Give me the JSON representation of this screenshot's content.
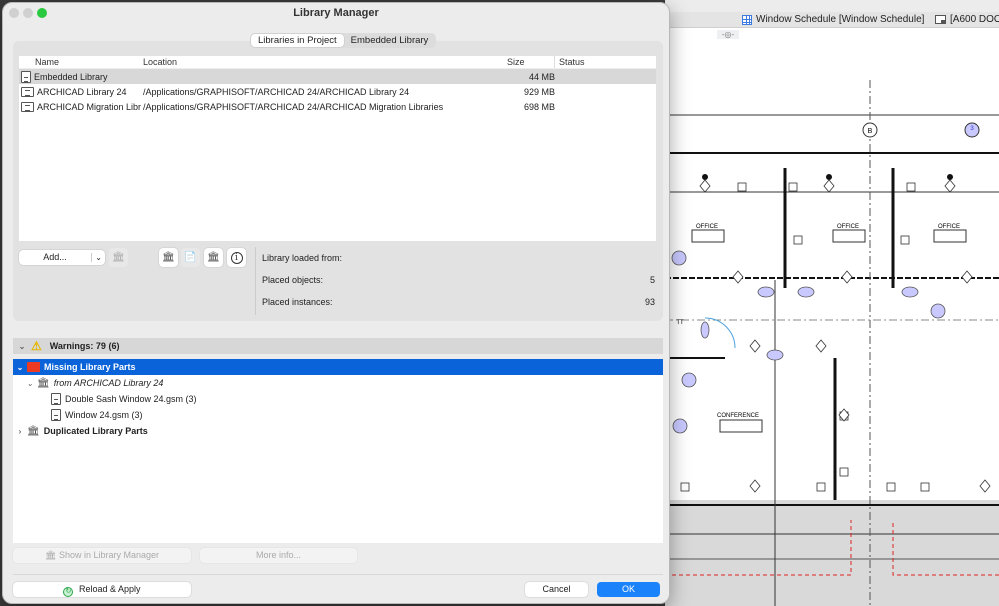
{
  "background_app": {
    "tabs": [
      {
        "label": "Window Schedule [Window Schedule]",
        "icon": "grid-icon"
      },
      {
        "label": "[A600 DOOR",
        "icon": "layout-icon"
      }
    ],
    "eye_tag": "-◎-",
    "plan_labels": {
      "office": "OFFICE",
      "conference": "CONFERENCE",
      "tt": "TT",
      "grid_b": "B",
      "section_3": "3"
    }
  },
  "dialog": {
    "title": "Library Manager",
    "tabs": [
      {
        "label": "Libraries in Project",
        "active": true
      },
      {
        "label": "Embedded Library",
        "active": false
      }
    ],
    "table": {
      "columns": [
        "Name",
        "Location",
        "Size",
        "Status"
      ],
      "rows": [
        {
          "name": "Embedded Library",
          "location": "",
          "size": "44 MB",
          "status": "",
          "icon": "document-icon",
          "selected": true
        },
        {
          "name": "ARCHICAD Library 24",
          "location": "/Applications/GRAPHISOFT/ARCHICAD 24/ARCHICAD Library 24",
          "size": "929 MB",
          "status": "",
          "icon": "library-folder-icon",
          "selected": false
        },
        {
          "name": "ARCHICAD Migration Libra...",
          "location": "/Applications/GRAPHISOFT/ARCHICAD 24/ARCHICAD Migration Libraries",
          "size": "698 MB",
          "status": "",
          "icon": "library-folder-icon",
          "selected": false
        }
      ]
    },
    "toolbar": {
      "add_label": "Add...",
      "buttons": [
        {
          "name": "remove-library",
          "icon": "remove-library-icon",
          "enabled": false
        },
        {
          "name": "add-server-library",
          "icon": "server-library-icon",
          "enabled": true
        },
        {
          "name": "embed-library",
          "icon": "embed-library-icon",
          "enabled": false
        },
        {
          "name": "reload-library",
          "icon": "library-reload-icon",
          "enabled": true
        },
        {
          "name": "info",
          "icon": "info-icon",
          "enabled": true
        }
      ]
    },
    "info": {
      "loaded_from_label": "Library loaded from:",
      "loaded_from_value": "",
      "placed_objects_label": "Placed objects:",
      "placed_objects_value": "5",
      "placed_instances_label": "Placed instances:",
      "placed_instances_value": "93"
    },
    "warnings": {
      "header": "Warnings: 79 (6)",
      "tree": [
        {
          "label": "Missing Library Parts",
          "level": 0,
          "expanded": true,
          "selected": true,
          "icon": "red-folder-icon",
          "bold": true
        },
        {
          "label": "from ARCHICAD Library 24",
          "level": 1,
          "expanded": true,
          "selected": false,
          "icon": "library-icon",
          "italic": true
        },
        {
          "label": "Double Sash Window 24.gsm (3)",
          "level": 2,
          "selected": false,
          "icon": "document-icon"
        },
        {
          "label": "Window 24.gsm (3)",
          "level": 2,
          "selected": false,
          "icon": "document-icon"
        },
        {
          "label": "Duplicated Library Parts",
          "level": 0,
          "expanded": false,
          "selected": false,
          "icon": "library-icon",
          "bold": true
        }
      ]
    },
    "buttons": {
      "show_in_manager": "Show in Library Manager",
      "more_info": "More info...",
      "reload_apply": "Reload & Apply",
      "cancel": "Cancel",
      "ok": "OK"
    },
    "colors": {
      "accent": "#0a63d8",
      "primary_button": "#1a82fb",
      "warning_folder": "#ec3b22",
      "traffic_green": "#2ac940"
    }
  }
}
